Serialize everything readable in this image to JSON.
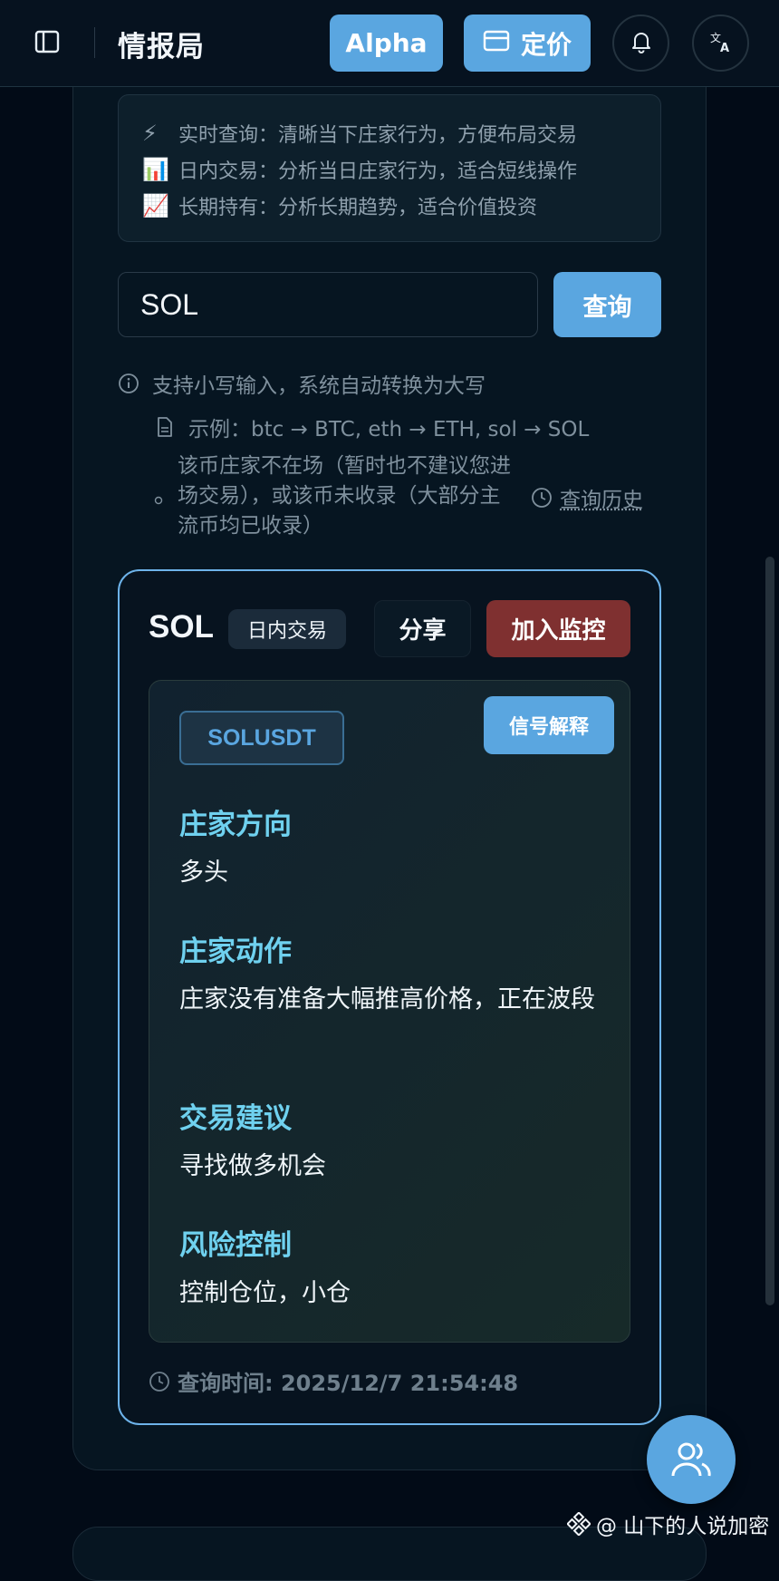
{
  "header": {
    "title": "情报局",
    "alpha_label": "Alpha",
    "pricing_label": "定价",
    "icons": {
      "sidebar": "sidebar-toggle-icon",
      "pricing": "credit-card-icon",
      "notifications": "bell-icon",
      "language": "translate-icon"
    }
  },
  "modes": [
    {
      "emoji": "⚡",
      "text": "实时查询：清晰当下庄家行为，方便布局交易"
    },
    {
      "emoji": "📊",
      "text": "日内交易：分析当日庄家行为，适合短线操作"
    },
    {
      "emoji": "📈",
      "text": "长期持有：分析长期趋势，适合价值投资"
    }
  ],
  "search": {
    "value": "SOL",
    "button": "查询"
  },
  "hints": {
    "uppercase": "支持小写输入，系统自动转换为大写",
    "example": "示例：btc → BTC, eth → ETH, sol → SOL",
    "not_listed": "该币庄家不在场（暂时也不建议您进场交易），或该币未收录（大部分主流币均已收录）",
    "history": "查询历史"
  },
  "result": {
    "coin": "SOL",
    "mode": "日内交易",
    "share": "分享",
    "monitor": "加入监控",
    "pair": "SOLUSDT",
    "explain": "信号解释",
    "sections": [
      {
        "title": "庄家方向",
        "body": "多头"
      },
      {
        "title": "庄家动作",
        "body": "庄家没有准备大幅推高价格，正在波段"
      },
      {
        "title": "交易建议",
        "body": "寻找做多机会"
      },
      {
        "title": "风险控制",
        "body": "控制仓位，小仓"
      }
    ],
    "query_time": "查询时间: 2025/12/7 21:54:48"
  },
  "watermark": "@ 山下的人说加密",
  "colors": {
    "accent": "#5aa6e0",
    "danger": "#7f3030",
    "section_title": "#6fd1ef",
    "background": "#020b17"
  }
}
